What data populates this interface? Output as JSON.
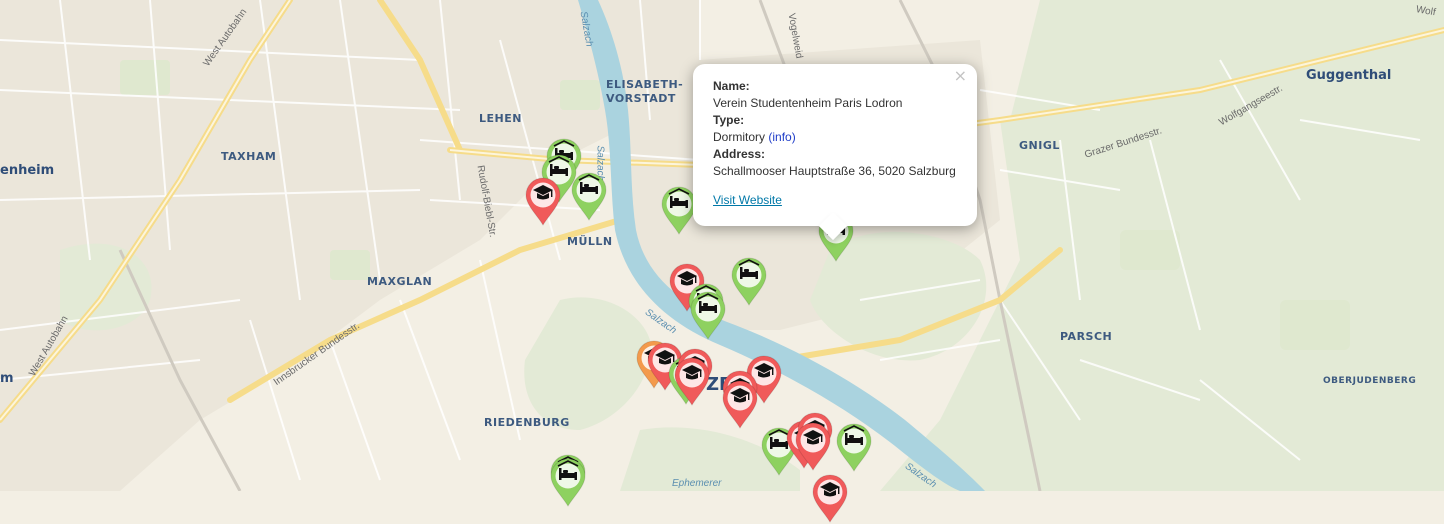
{
  "map": {
    "districts": [
      {
        "id": "lehen",
        "text": "LEHEN"
      },
      {
        "id": "elisabeth-vorstadt-1",
        "text": "ELISABETH-"
      },
      {
        "id": "elisabeth-vorstadt-2",
        "text": "VORSTADT"
      },
      {
        "id": "taxham",
        "text": "TAXHAM"
      },
      {
        "id": "muelln",
        "text": "MÜLLN"
      },
      {
        "id": "maxglan",
        "text": "MAXGLAN"
      },
      {
        "id": "riedenburg",
        "text": "RIEDENBURG"
      },
      {
        "id": "gnigl",
        "text": "GNIGL"
      },
      {
        "id": "parsch",
        "text": "PARSCH"
      },
      {
        "id": "oberjudenberg",
        "text": "OBERJUDENBERG"
      },
      {
        "id": "guggenthal",
        "text": "Guggenthal"
      },
      {
        "id": "wals-heim",
        "text": "enheim"
      },
      {
        "id": "left-m",
        "text": "m"
      },
      {
        "id": "center-ze",
        "text": "ZE"
      }
    ],
    "streets": [
      {
        "id": "west-autobahn-1",
        "text": "West Autobahn"
      },
      {
        "id": "west-autobahn-2",
        "text": "West Autobahn"
      },
      {
        "id": "salzach-1",
        "text": "Salzach"
      },
      {
        "id": "salzach-2",
        "text": "Salzach"
      },
      {
        "id": "salzach-3",
        "text": "Salzach"
      },
      {
        "id": "salzach-4",
        "text": "Salzach"
      },
      {
        "id": "rudolf-biebl",
        "text": "Rudolf-Biebl-Str."
      },
      {
        "id": "vogelweid",
        "text": "Vogelweid"
      },
      {
        "id": "innsbrucker",
        "text": "Innsbrucker Bundesstr."
      },
      {
        "id": "grazer",
        "text": "Grazer Bundesstr."
      },
      {
        "id": "wolfgangsee",
        "text": "Wolfgangseestr."
      },
      {
        "id": "wolf",
        "text": "Wolf"
      },
      {
        "id": "ephemerer",
        "text": "Ephemerer"
      }
    ],
    "legend_colors": {
      "dormitory": "#8ed160",
      "university": "#f05a5a",
      "other": "#f39a4c"
    },
    "markers": [
      {
        "type": "dormitory",
        "icon": "bed-icon"
      },
      {
        "type": "dormitory",
        "icon": "bed-icon"
      },
      {
        "type": "university",
        "icon": "graduation-cap-icon"
      },
      {
        "type": "dormitory",
        "icon": "bed-icon"
      },
      {
        "type": "dormitory",
        "icon": "bed-icon"
      },
      {
        "type": "dormitory",
        "icon": "bed-icon",
        "selected": true
      },
      {
        "type": "university",
        "icon": "graduation-cap-icon"
      },
      {
        "type": "dormitory",
        "icon": "bed-icon"
      },
      {
        "type": "dormitory",
        "icon": "bed-icon"
      },
      {
        "type": "dormitory",
        "icon": "bed-icon"
      },
      {
        "type": "other",
        "icon": "graduation-cap-icon"
      },
      {
        "type": "university",
        "icon": "graduation-cap-icon"
      },
      {
        "type": "dormitory",
        "icon": "bed-icon"
      },
      {
        "type": "university",
        "icon": "graduation-cap-icon"
      },
      {
        "type": "university",
        "icon": "graduation-cap-icon"
      },
      {
        "type": "university",
        "icon": "graduation-cap-icon"
      },
      {
        "type": "university",
        "icon": "graduation-cap-icon"
      },
      {
        "type": "university",
        "icon": "graduation-cap-icon"
      },
      {
        "type": "dormitory",
        "icon": "bed-icon"
      },
      {
        "type": "university",
        "icon": "graduation-cap-icon"
      },
      {
        "type": "university",
        "icon": "graduation-cap-icon"
      },
      {
        "type": "university",
        "icon": "graduation-cap-icon"
      },
      {
        "type": "dormitory",
        "icon": "bed-icon"
      },
      {
        "type": "dormitory",
        "icon": "bed-icon"
      },
      {
        "type": "dormitory",
        "icon": "bed-icon"
      },
      {
        "type": "university",
        "icon": "graduation-cap-icon"
      }
    ]
  },
  "popup": {
    "name_label": "Name:",
    "name_value": "Verein Studentenheim Paris Lodron",
    "type_label": "Type:",
    "type_value": "Dormitory",
    "info_link": "(info)",
    "address_label": "Address:",
    "address_value": "Schallmooser Hauptstraße 36, 5020 Salzburg",
    "website_link": "Visit Website",
    "close_symbol": "×"
  }
}
